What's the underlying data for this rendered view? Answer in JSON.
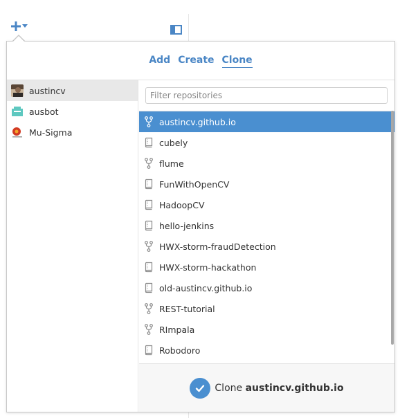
{
  "toolbar": {
    "add_icon": "plus-icon",
    "dropdown_icon": "chevron-down-icon",
    "sidebar_toggle_icon": "sidebar-toggle-icon"
  },
  "tabs": [
    {
      "label": "Add",
      "active": false
    },
    {
      "label": "Create",
      "active": false
    },
    {
      "label": "Clone",
      "active": true
    }
  ],
  "accounts": [
    {
      "name": "austincv",
      "selected": true
    },
    {
      "name": "ausbot",
      "selected": false
    },
    {
      "name": "Mu-Sigma",
      "selected": false
    }
  ],
  "filter": {
    "placeholder": "Filter repositories",
    "value": ""
  },
  "repositories": [
    {
      "name": "austincv.github.io",
      "type": "fork",
      "selected": true
    },
    {
      "name": "cubely",
      "type": "repo",
      "selected": false
    },
    {
      "name": "flume",
      "type": "fork",
      "selected": false
    },
    {
      "name": "FunWithOpenCV",
      "type": "repo",
      "selected": false
    },
    {
      "name": "HadoopCV",
      "type": "repo",
      "selected": false
    },
    {
      "name": "hello-jenkins",
      "type": "repo",
      "selected": false
    },
    {
      "name": "HWX-storm-fraudDetection",
      "type": "fork",
      "selected": false
    },
    {
      "name": "HWX-storm-hackathon",
      "type": "repo",
      "selected": false
    },
    {
      "name": "old-austincv.github.io",
      "type": "repo",
      "selected": false
    },
    {
      "name": "REST-tutorial",
      "type": "fork",
      "selected": false
    },
    {
      "name": "RImpala",
      "type": "fork",
      "selected": false
    },
    {
      "name": "Robodoro",
      "type": "repo",
      "selected": false
    }
  ],
  "footer": {
    "prefix": "Clone",
    "target": "austincv.github.io",
    "icon": "check-icon"
  },
  "colors": {
    "accent": "#4a86c5",
    "selection": "#4a8fd0"
  }
}
